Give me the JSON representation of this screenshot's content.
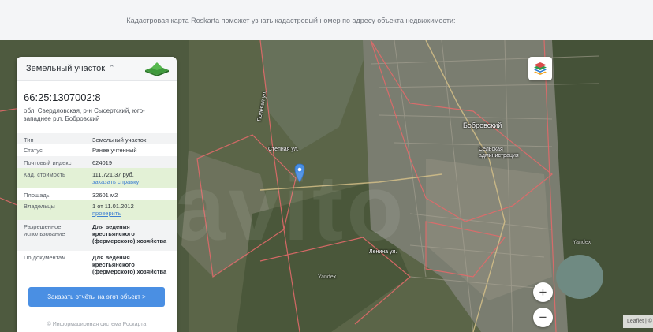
{
  "header": {
    "text": "Кадастровая карта Roskarta поможет узнать кадастровый номер по адресу объекта недвижимости:"
  },
  "panel": {
    "title": "Земельный участок",
    "cad_number": "66:25:1307002:8",
    "address": "обл. Свердловская, р-н Сысертский, юго-западнее р.п. Бобровский",
    "rows": [
      {
        "key": "Тип",
        "value": "Земельный участок"
      },
      {
        "key": "Статус",
        "value": "Ранее учтенный"
      },
      {
        "key": "Почтовый индекс",
        "value": "624019"
      },
      {
        "key": "Кад. стоимость",
        "value": "111,721.37 руб.",
        "link": "заказать справку"
      },
      {
        "key": "Площадь",
        "value": "32601 м2"
      },
      {
        "key": "Владельцы",
        "value": "1 от 11.01.2012",
        "link": "проверить"
      },
      {
        "key": "Разрешенное использование",
        "value": "Для ведения крестьянского (фермерского) хозяйства"
      },
      {
        "key": "По документам",
        "value": "Для ведения крестьянского (фермерского) хозяйства"
      }
    ],
    "cta": "Заказать отчёты на этот объект >",
    "footer": "© Информационная система Роскарта"
  },
  "map": {
    "labels": {
      "town": "Бобровский",
      "admin": "Сельская администрация",
      "yandex": "Yandex",
      "street_1": "Полевая ул.",
      "street_2": "Степная ул.",
      "street_3": "Ленина ул."
    },
    "zoom_in": "+",
    "zoom_out": "−",
    "attribution": "Leaflet | ©",
    "watermark": "avito"
  },
  "colors": {
    "accent": "#4a8fe3",
    "marker": "#4a8fe3",
    "boundary": "#e26a6a",
    "green_row": "#e3f1d6"
  }
}
